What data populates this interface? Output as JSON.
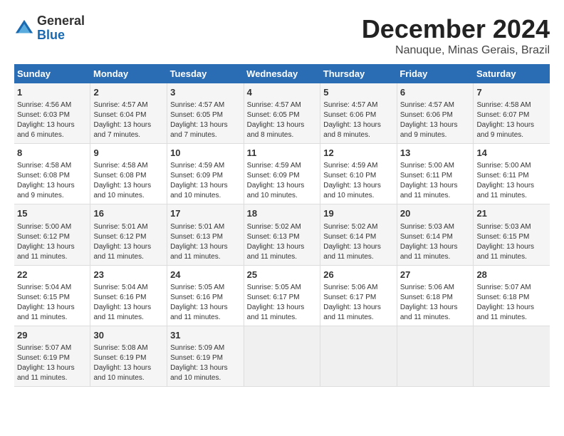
{
  "header": {
    "logo_general": "General",
    "logo_blue": "Blue",
    "month_title": "December 2024",
    "location": "Nanuque, Minas Gerais, Brazil"
  },
  "columns": [
    "Sunday",
    "Monday",
    "Tuesday",
    "Wednesday",
    "Thursday",
    "Friday",
    "Saturday"
  ],
  "weeks": [
    [
      {
        "day": "1",
        "line1": "Sunrise: 4:56 AM",
        "line2": "Sunset: 6:03 PM",
        "line3": "Daylight: 13 hours",
        "line4": "and 6 minutes."
      },
      {
        "day": "2",
        "line1": "Sunrise: 4:57 AM",
        "line2": "Sunset: 6:04 PM",
        "line3": "Daylight: 13 hours",
        "line4": "and 7 minutes."
      },
      {
        "day": "3",
        "line1": "Sunrise: 4:57 AM",
        "line2": "Sunset: 6:05 PM",
        "line3": "Daylight: 13 hours",
        "line4": "and 7 minutes."
      },
      {
        "day": "4",
        "line1": "Sunrise: 4:57 AM",
        "line2": "Sunset: 6:05 PM",
        "line3": "Daylight: 13 hours",
        "line4": "and 8 minutes."
      },
      {
        "day": "5",
        "line1": "Sunrise: 4:57 AM",
        "line2": "Sunset: 6:06 PM",
        "line3": "Daylight: 13 hours",
        "line4": "and 8 minutes."
      },
      {
        "day": "6",
        "line1": "Sunrise: 4:57 AM",
        "line2": "Sunset: 6:06 PM",
        "line3": "Daylight: 13 hours",
        "line4": "and 9 minutes."
      },
      {
        "day": "7",
        "line1": "Sunrise: 4:58 AM",
        "line2": "Sunset: 6:07 PM",
        "line3": "Daylight: 13 hours",
        "line4": "and 9 minutes."
      }
    ],
    [
      {
        "day": "8",
        "line1": "Sunrise: 4:58 AM",
        "line2": "Sunset: 6:08 PM",
        "line3": "Daylight: 13 hours",
        "line4": "and 9 minutes."
      },
      {
        "day": "9",
        "line1": "Sunrise: 4:58 AM",
        "line2": "Sunset: 6:08 PM",
        "line3": "Daylight: 13 hours",
        "line4": "and 10 minutes."
      },
      {
        "day": "10",
        "line1": "Sunrise: 4:59 AM",
        "line2": "Sunset: 6:09 PM",
        "line3": "Daylight: 13 hours",
        "line4": "and 10 minutes."
      },
      {
        "day": "11",
        "line1": "Sunrise: 4:59 AM",
        "line2": "Sunset: 6:09 PM",
        "line3": "Daylight: 13 hours",
        "line4": "and 10 minutes."
      },
      {
        "day": "12",
        "line1": "Sunrise: 4:59 AM",
        "line2": "Sunset: 6:10 PM",
        "line3": "Daylight: 13 hours",
        "line4": "and 10 minutes."
      },
      {
        "day": "13",
        "line1": "Sunrise: 5:00 AM",
        "line2": "Sunset: 6:11 PM",
        "line3": "Daylight: 13 hours",
        "line4": "and 11 minutes."
      },
      {
        "day": "14",
        "line1": "Sunrise: 5:00 AM",
        "line2": "Sunset: 6:11 PM",
        "line3": "Daylight: 13 hours",
        "line4": "and 11 minutes."
      }
    ],
    [
      {
        "day": "15",
        "line1": "Sunrise: 5:00 AM",
        "line2": "Sunset: 6:12 PM",
        "line3": "Daylight: 13 hours",
        "line4": "and 11 minutes."
      },
      {
        "day": "16",
        "line1": "Sunrise: 5:01 AM",
        "line2": "Sunset: 6:12 PM",
        "line3": "Daylight: 13 hours",
        "line4": "and 11 minutes."
      },
      {
        "day": "17",
        "line1": "Sunrise: 5:01 AM",
        "line2": "Sunset: 6:13 PM",
        "line3": "Daylight: 13 hours",
        "line4": "and 11 minutes."
      },
      {
        "day": "18",
        "line1": "Sunrise: 5:02 AM",
        "line2": "Sunset: 6:13 PM",
        "line3": "Daylight: 13 hours",
        "line4": "and 11 minutes."
      },
      {
        "day": "19",
        "line1": "Sunrise: 5:02 AM",
        "line2": "Sunset: 6:14 PM",
        "line3": "Daylight: 13 hours",
        "line4": "and 11 minutes."
      },
      {
        "day": "20",
        "line1": "Sunrise: 5:03 AM",
        "line2": "Sunset: 6:14 PM",
        "line3": "Daylight: 13 hours",
        "line4": "and 11 minutes."
      },
      {
        "day": "21",
        "line1": "Sunrise: 5:03 AM",
        "line2": "Sunset: 6:15 PM",
        "line3": "Daylight: 13 hours",
        "line4": "and 11 minutes."
      }
    ],
    [
      {
        "day": "22",
        "line1": "Sunrise: 5:04 AM",
        "line2": "Sunset: 6:15 PM",
        "line3": "Daylight: 13 hours",
        "line4": "and 11 minutes."
      },
      {
        "day": "23",
        "line1": "Sunrise: 5:04 AM",
        "line2": "Sunset: 6:16 PM",
        "line3": "Daylight: 13 hours",
        "line4": "and 11 minutes."
      },
      {
        "day": "24",
        "line1": "Sunrise: 5:05 AM",
        "line2": "Sunset: 6:16 PM",
        "line3": "Daylight: 13 hours",
        "line4": "and 11 minutes."
      },
      {
        "day": "25",
        "line1": "Sunrise: 5:05 AM",
        "line2": "Sunset: 6:17 PM",
        "line3": "Daylight: 13 hours",
        "line4": "and 11 minutes."
      },
      {
        "day": "26",
        "line1": "Sunrise: 5:06 AM",
        "line2": "Sunset: 6:17 PM",
        "line3": "Daylight: 13 hours",
        "line4": "and 11 minutes."
      },
      {
        "day": "27",
        "line1": "Sunrise: 5:06 AM",
        "line2": "Sunset: 6:18 PM",
        "line3": "Daylight: 13 hours",
        "line4": "and 11 minutes."
      },
      {
        "day": "28",
        "line1": "Sunrise: 5:07 AM",
        "line2": "Sunset: 6:18 PM",
        "line3": "Daylight: 13 hours",
        "line4": "and 11 minutes."
      }
    ],
    [
      {
        "day": "29",
        "line1": "Sunrise: 5:07 AM",
        "line2": "Sunset: 6:19 PM",
        "line3": "Daylight: 13 hours",
        "line4": "and 11 minutes."
      },
      {
        "day": "30",
        "line1": "Sunrise: 5:08 AM",
        "line2": "Sunset: 6:19 PM",
        "line3": "Daylight: 13 hours",
        "line4": "and 10 minutes."
      },
      {
        "day": "31",
        "line1": "Sunrise: 5:09 AM",
        "line2": "Sunset: 6:19 PM",
        "line3": "Daylight: 13 hours",
        "line4": "and 10 minutes."
      },
      {
        "day": "",
        "line1": "",
        "line2": "",
        "line3": "",
        "line4": ""
      },
      {
        "day": "",
        "line1": "",
        "line2": "",
        "line3": "",
        "line4": ""
      },
      {
        "day": "",
        "line1": "",
        "line2": "",
        "line3": "",
        "line4": ""
      },
      {
        "day": "",
        "line1": "",
        "line2": "",
        "line3": "",
        "line4": ""
      }
    ]
  ]
}
